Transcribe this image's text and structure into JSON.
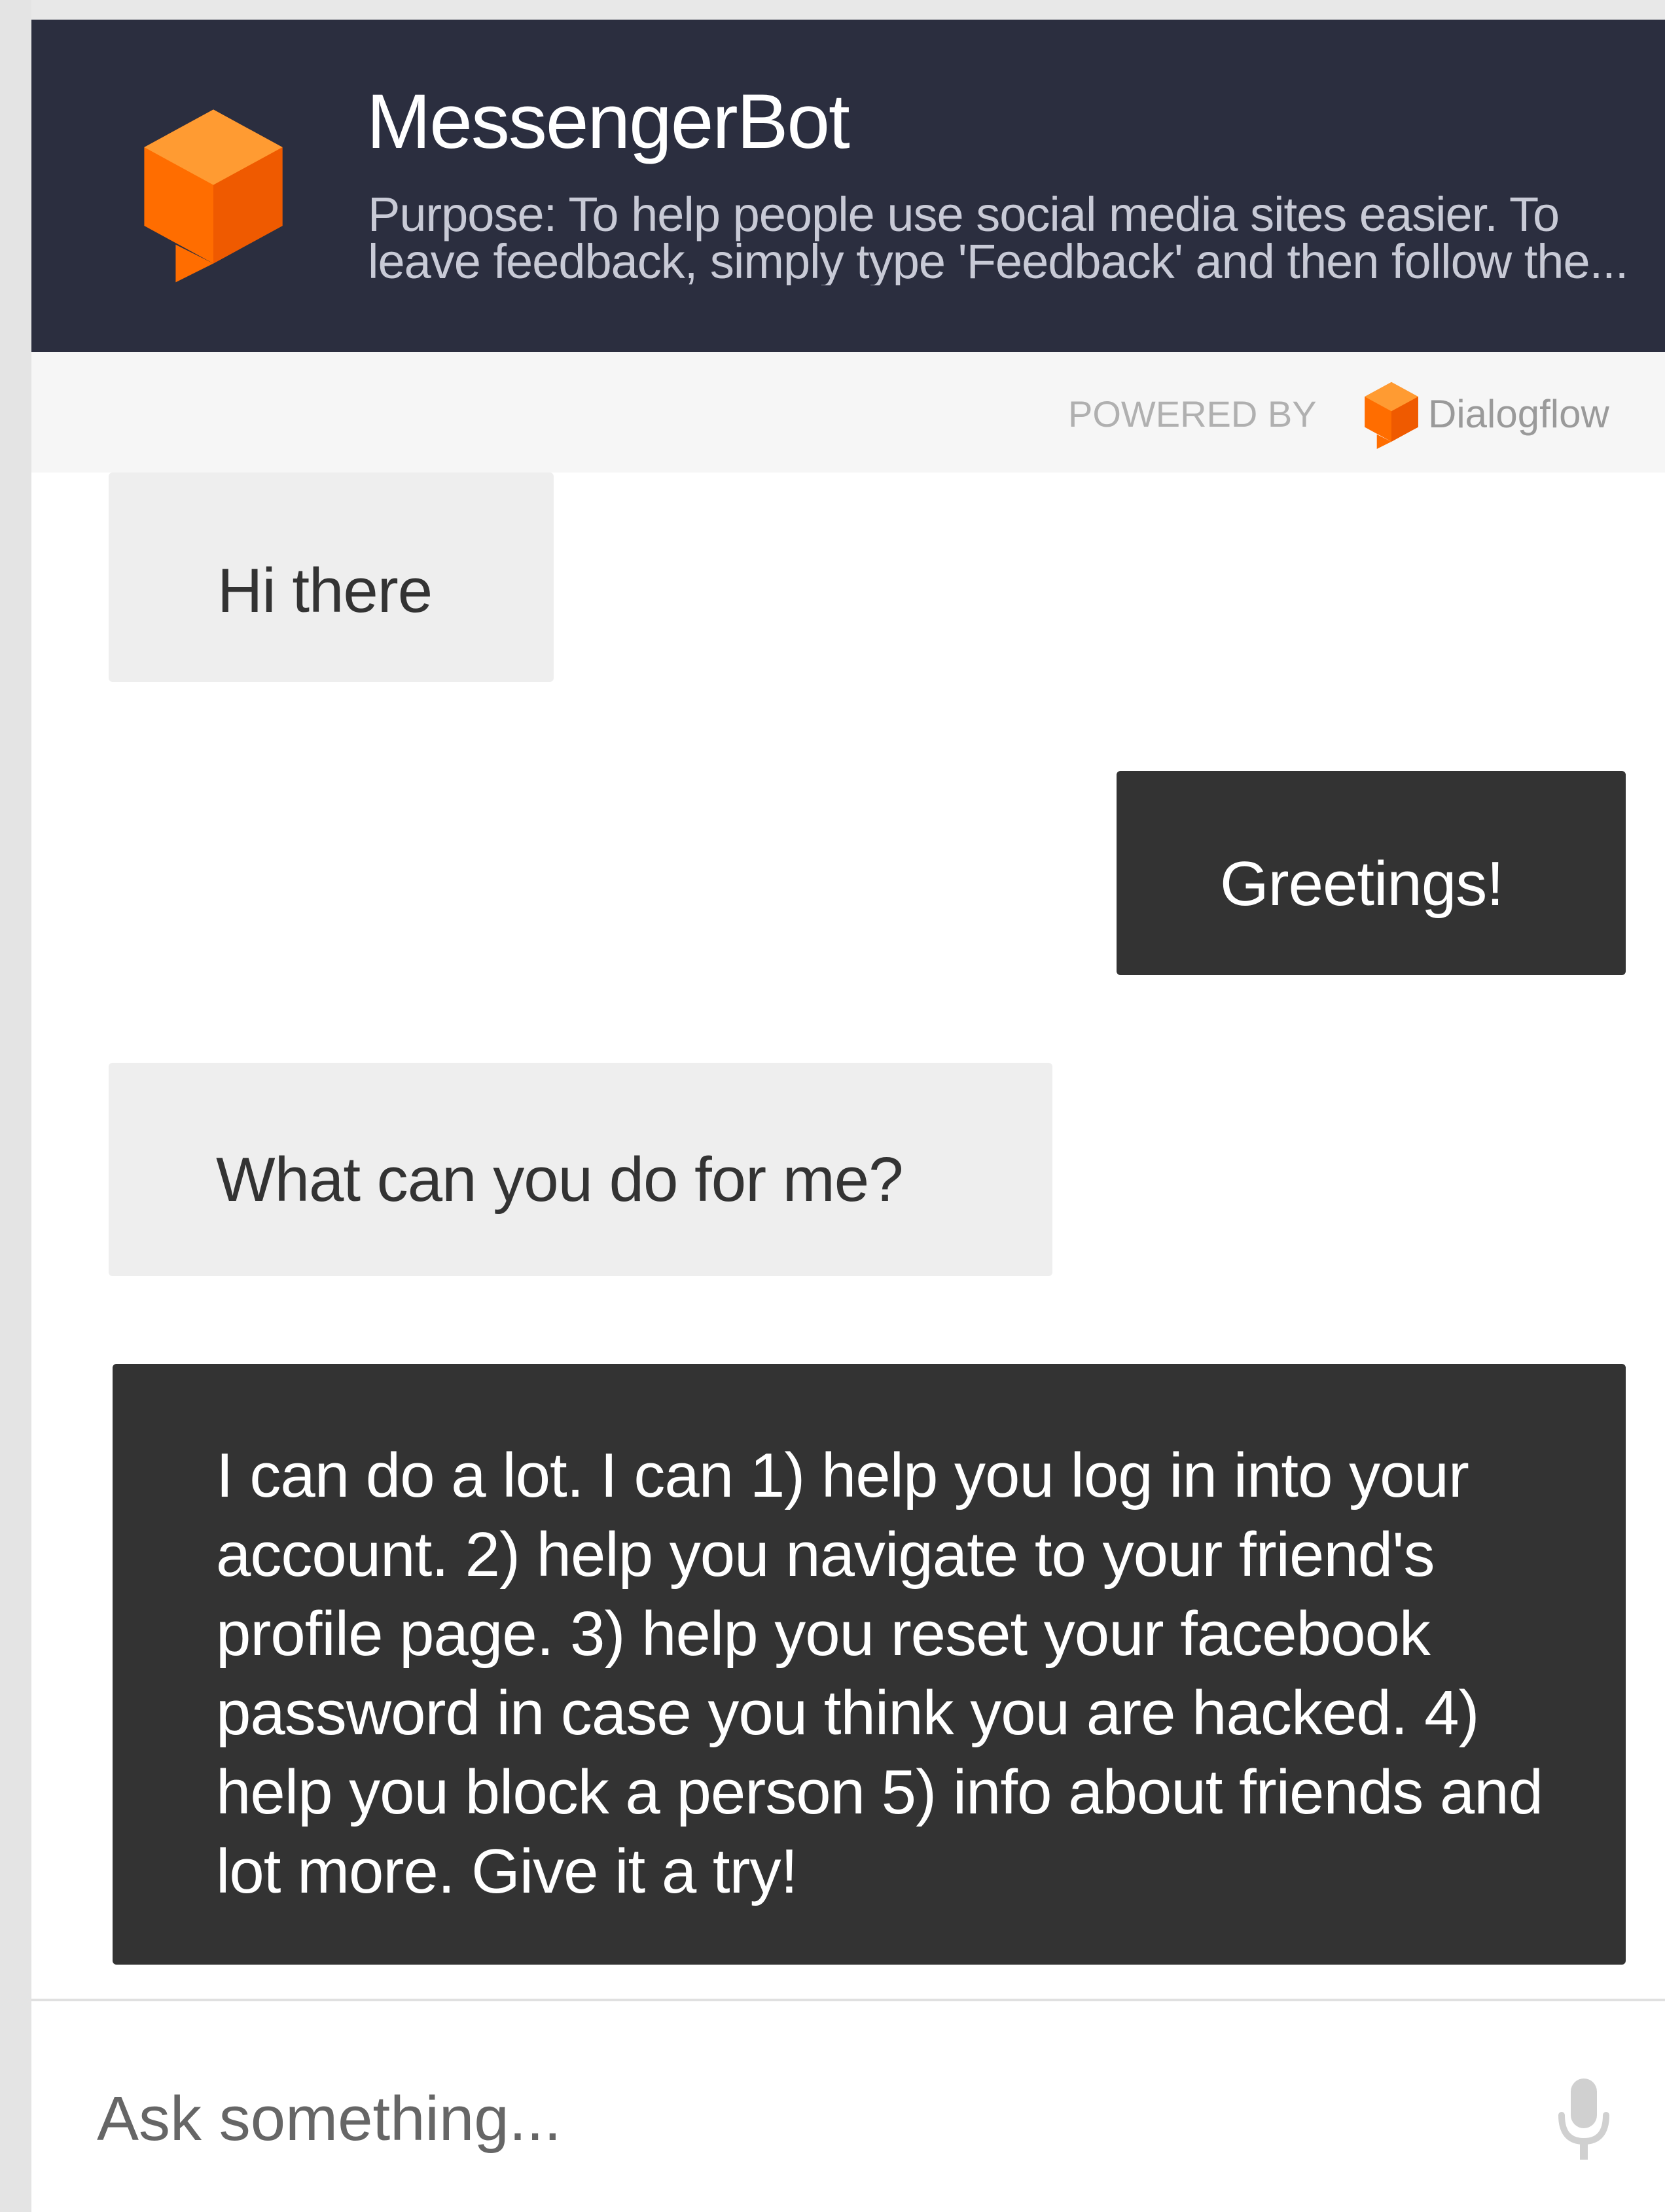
{
  "header": {
    "bot_name": "MessengerBot",
    "purpose": "Purpose: To help people use social media sites easier. To leave feedback, simply type 'Feedback' and then follow the..."
  },
  "powered_by": {
    "label": "POWERED BY",
    "brand": "Dialogflow"
  },
  "messages": [
    {
      "sender": "bot",
      "text": "Hi there"
    },
    {
      "sender": "user",
      "text": "Greetings!"
    },
    {
      "sender": "bot",
      "text": "What can you do for me?"
    },
    {
      "sender": "user",
      "text": "I can do a lot. I can 1) help you log in into your account. 2) help you navigate to your friend's profile page. 3) help you reset your facebook password in case you think you are hacked. 4) help you block a person 5) info about friends and lot more. Give it a try!"
    }
  ],
  "input": {
    "placeholder": "Ask something..."
  },
  "icons": {
    "logo": "dialogflow-logo-icon",
    "mic": "microphone-icon"
  },
  "colors": {
    "header_bg": "#2b2e3f",
    "brand_orange": "#ff6d00",
    "user_bubble": "#333333",
    "bot_bubble": "#eeeeee"
  }
}
